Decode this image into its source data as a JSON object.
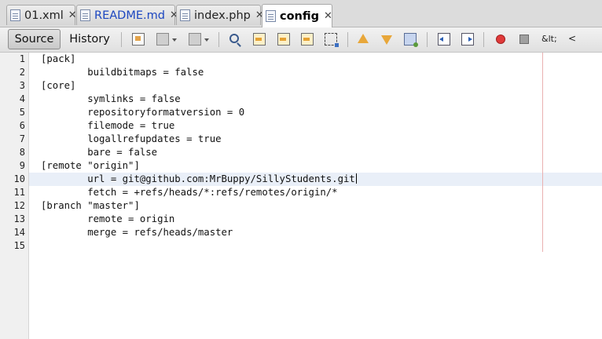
{
  "tabs": [
    {
      "label": "01.xml",
      "active": false,
      "icon": "xml-file-icon"
    },
    {
      "label": "README.md",
      "active": false,
      "icon": "markdown-file-icon"
    },
    {
      "label": "index.php",
      "active": false,
      "icon": "php-file-icon"
    },
    {
      "label": "config",
      "active": true,
      "icon": "config-file-icon"
    }
  ],
  "tab_close_glyph": "✕",
  "toolbar": {
    "source_label": "Source",
    "history_label": "History",
    "entity_label": "&lt;",
    "lt_label": "<"
  },
  "editor": {
    "line_numbers": [
      "1",
      "2",
      "3",
      "4",
      "5",
      "6",
      "7",
      "8",
      "9",
      "10",
      "11",
      "12",
      "13",
      "14",
      "15"
    ],
    "lines": [
      "[pack]",
      "        buildbitmaps = false",
      "[core]",
      "        symlinks = false",
      "        repositoryformatversion = 0",
      "        filemode = true",
      "        logallrefupdates = true",
      "        bare = false",
      "[remote \"origin\"]",
      "        url = git@github.com:MrBuppy/SillyStudents.git",
      "        fetch = +refs/heads/*:refs/remotes/origin/*",
      "[branch \"master\"]",
      "        remote = origin",
      "        merge = refs/heads/master",
      ""
    ],
    "current_line": 10
  }
}
